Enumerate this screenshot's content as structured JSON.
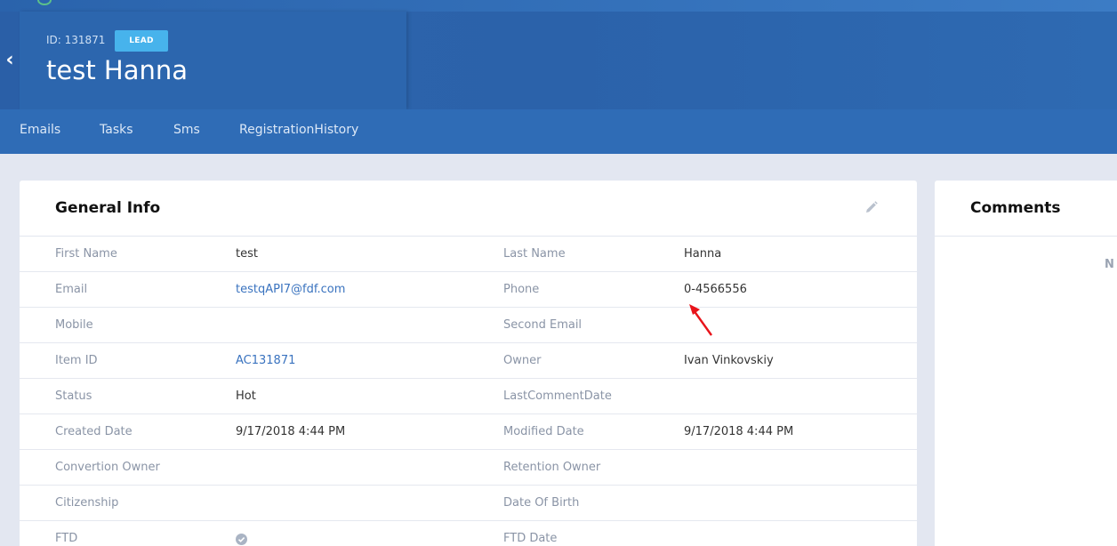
{
  "header": {
    "id_text": "ID: 131871",
    "badge": "LEAD",
    "name": "test Hanna"
  },
  "tabs": [
    {
      "label": "Emails"
    },
    {
      "label": "Tasks"
    },
    {
      "label": "Sms"
    },
    {
      "label": "RegistrationHistory"
    }
  ],
  "general_info": {
    "title": "General Info",
    "rows": [
      {
        "l1": "First Name",
        "v1": "test",
        "l2": "Last Name",
        "v2": "Hanna"
      },
      {
        "l1": "Email",
        "v1": "testqAPI7@fdf.com",
        "l2": "Phone",
        "v2": "0-4566556"
      },
      {
        "l1": "Mobile",
        "v1": "",
        "l2": "Second Email",
        "v2": ""
      },
      {
        "l1": "Item ID",
        "v1": "AC131871",
        "l2": "Owner",
        "v2": "Ivan Vinkovskiy"
      },
      {
        "l1": "Status",
        "v1": "Hot",
        "l2": "LastCommentDate",
        "v2": ""
      },
      {
        "l1": "Created Date",
        "v1": "9/17/2018 4:44 PM",
        "l2": "Modified Date",
        "v2": "9/17/2018 4:44 PM"
      },
      {
        "l1": "Convertion Owner",
        "v1": "",
        "l2": "Retention Owner",
        "v2": ""
      },
      {
        "l1": "Citizenship",
        "v1": "",
        "l2": "Date Of Birth",
        "v2": ""
      },
      {
        "l1": "FTD",
        "v1": "",
        "l2": "FTD Date",
        "v2": ""
      }
    ]
  },
  "comments": {
    "title": "Comments",
    "empty_text": "N"
  },
  "colors": {
    "header": "#2c66ae",
    "tabs": "#2f6cb6",
    "badge": "#47b3ec",
    "link": "#3a73bf",
    "annotation_arrow": "#e8141b"
  },
  "icons": {
    "back": "chevron-left-icon",
    "edit": "pencil-icon",
    "ftd": "check-circle-icon"
  }
}
